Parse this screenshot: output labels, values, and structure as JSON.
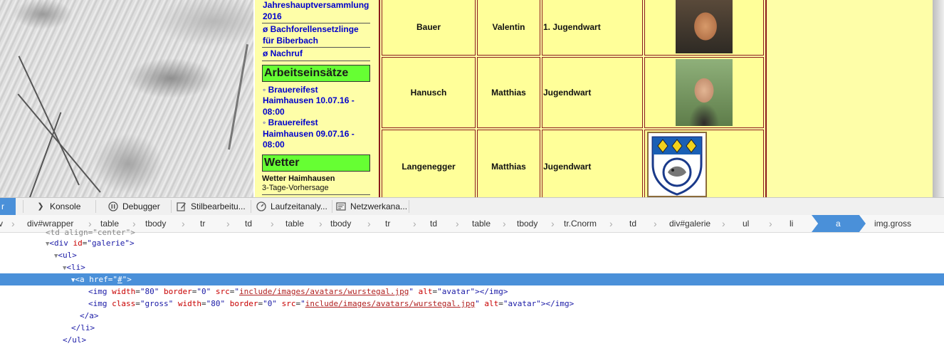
{
  "nav": {
    "news_items": [
      {
        "label": "Jahreshauptversammlung 2016"
      },
      {
        "label": "ø Bachforellensetzlinge für Biberbach"
      },
      {
        "label": "ø Nachruf"
      }
    ],
    "section_work": "Arbeitseinsätze",
    "work_items": [
      {
        "label": "◦ Brauereifest Haimhausen 10.07.16 - 08:00"
      },
      {
        "label": "◦ Brauereifest Haimhausen 09.07.16 - 08:00"
      }
    ],
    "section_weather": "Wetter",
    "weather_title": "Wetter Haimhausen",
    "weather_sub": "3-Tage-Vorhersage"
  },
  "members": [
    {
      "surname": "Bauer",
      "firstname": "Valentin",
      "role": "1. Jugendwart",
      "pic": "avatar"
    },
    {
      "surname": "Hanusch",
      "firstname": "Matthias",
      "role": "Jugendwart",
      "pic": "avatar"
    },
    {
      "surname": "Langenegger",
      "firstname": "Matthias",
      "role": "Jugendwart",
      "pic": "avatar"
    }
  ],
  "devtools": {
    "tabs": [
      {
        "label": "r",
        "icon": "inspector-icon"
      },
      {
        "label": "Konsole",
        "icon": "console-icon"
      },
      {
        "label": "Debugger",
        "icon": "debugger-icon"
      },
      {
        "label": "Stilbearbeitu...",
        "icon": "style-editor-icon"
      },
      {
        "label": "Laufzeitanaly...",
        "icon": "performance-icon"
      },
      {
        "label": "Netzwerkana...",
        "icon": "network-icon"
      }
    ],
    "breadcrumbs": [
      "v",
      "div#wrapper",
      "table",
      "tbody",
      "tr",
      "td",
      "table",
      "tbody",
      "tr",
      "td",
      "table",
      "tbody",
      "tr.Cnorm",
      "td",
      "div#galerie",
      "ul",
      "li",
      "a",
      "img.gross"
    ],
    "markup": {
      "line0": "<td align=\"center\">",
      "line1_tag": "div",
      "line1_attr": "id",
      "line1_val": "galerie",
      "line2_tag": "ul",
      "line3_tag": "li",
      "line4_tag": "a",
      "line4_attr": "href",
      "line4_val": "#",
      "img1": {
        "width": "80",
        "border": "0",
        "src": "include/images/avatars/wurstegal.jpg",
        "alt": "avatar"
      },
      "img2": {
        "class": "gross",
        "width": "80",
        "border": "0",
        "src": "include/images/avatars/wurstegal.jpg",
        "alt": "avatar"
      },
      "close_a": "</a>",
      "close_li": "</li>",
      "close_ul": "</ul>"
    }
  },
  "colors": {
    "page_bg": "#fefea8",
    "cell_bg": "#ffff99",
    "section_green": "#66ff33",
    "selection_blue": "#4a90d9"
  }
}
